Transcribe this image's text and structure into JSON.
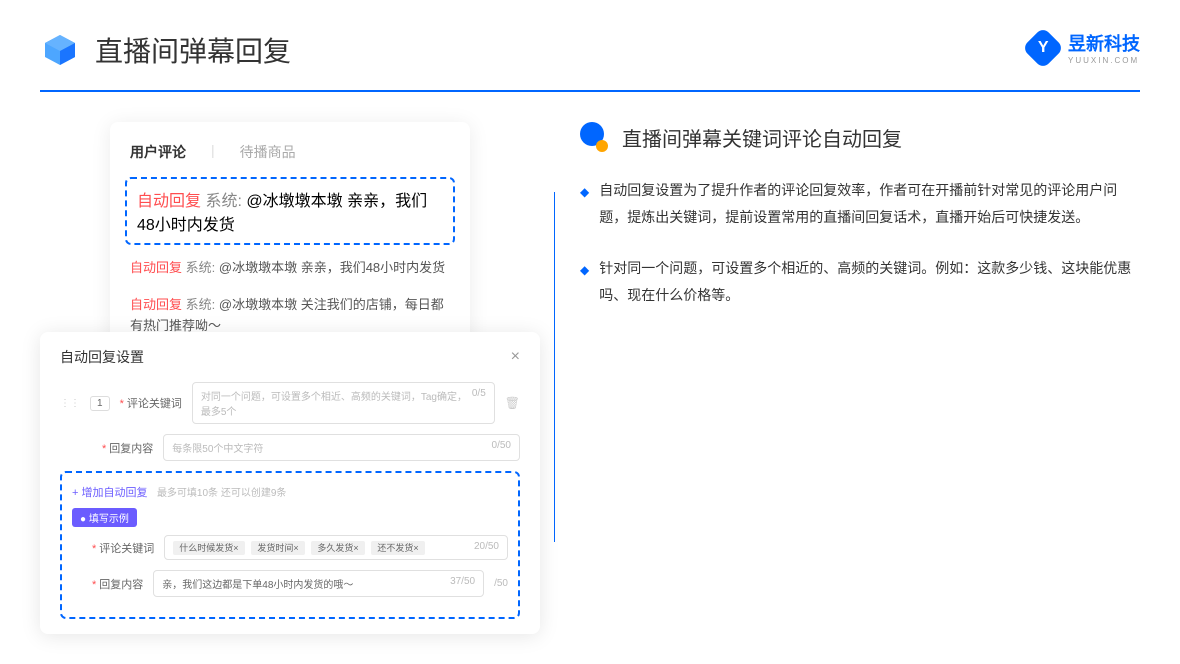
{
  "header": {
    "title": "直播间弹幕回复"
  },
  "logo": {
    "brand": "昱新科技",
    "sub": "YUUXIN.COM",
    "letter": "Y"
  },
  "comments_panel": {
    "tab_active": "用户评论",
    "tab_inactive": "待播商品",
    "auto_label": "自动回复",
    "sys_label": "系统:",
    "items": [
      "@冰墩墩本墩 亲亲，我们48小时内发货",
      "@冰墩墩本墩 亲亲，我们48小时内发货",
      "@冰墩墩本墩 关注我们的店铺，每日都有热门推荐呦～"
    ]
  },
  "settings_panel": {
    "title": "自动回复设置",
    "num": "1",
    "keyword_label": "评论关键词",
    "keyword_placeholder": "对同一个问题，可设置多个相近、高频的关键词，Tag确定，最多5个",
    "keyword_count": "0/5",
    "content_label": "回复内容",
    "content_placeholder": "每条限50个中文字符",
    "content_count": "0/50",
    "add_link": "+ 增加自动回复",
    "add_hint": "最多可填10条 还可以创建9条",
    "example_badge": "● 填写示例",
    "example_keyword_label": "评论关键词",
    "example_tags": [
      "什么时候发货×",
      "发货时间×",
      "多久发货×",
      "还不发货×"
    ],
    "example_keyword_count": "20/50",
    "example_content_label": "回复内容",
    "example_content": "亲，我们这边都是下单48小时内发货的哦～",
    "example_content_count": "37/50",
    "outer_count": "/50"
  },
  "right_section": {
    "title": "直播间弹幕关键词评论自动回复",
    "bullets": [
      "自动回复设置为了提升作者的评论回复效率，作者可在开播前针对常见的评论用户问题，提炼出关键词，提前设置常用的直播间回复话术，直播开始后可快捷发送。",
      "针对同一个问题，可设置多个相近的、高频的关键词。例如：这款多少钱、这块能优惠吗、现在什么价格等。"
    ]
  }
}
